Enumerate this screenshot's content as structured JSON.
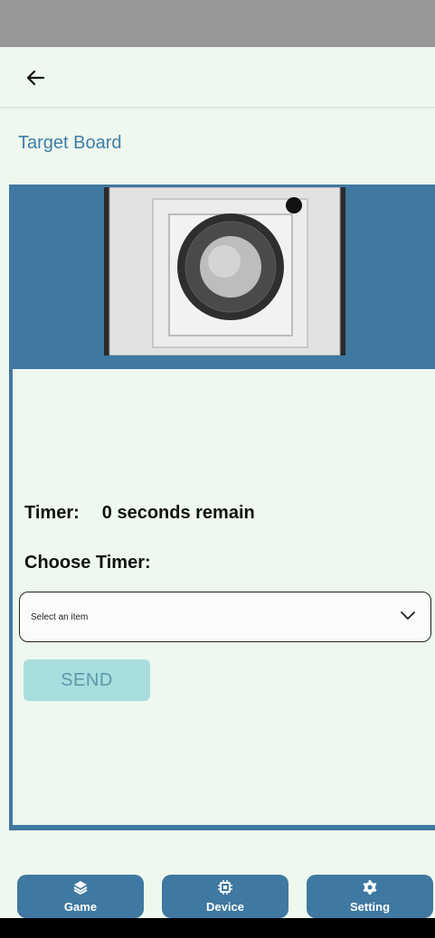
{
  "header": {
    "back_icon": "arrow-left-icon"
  },
  "page": {
    "title": "Target Board"
  },
  "photo": {
    "subject": "target-board-photo"
  },
  "timer": {
    "label": "Timer:",
    "value": "0 seconds remain"
  },
  "choose": {
    "label": "Choose Timer:"
  },
  "select": {
    "placeholder": "Select an item",
    "icon": "chevron-down-icon"
  },
  "send": {
    "label": "SEND"
  },
  "nav": [
    {
      "label": "Game",
      "icon": "layers-icon"
    },
    {
      "label": "Device",
      "icon": "chip-icon"
    },
    {
      "label": "Setting",
      "icon": "gear-icon"
    }
  ],
  "colors": {
    "background": "#eef8ee",
    "primary": "#3f78a0",
    "title": "#3d7ea6",
    "send_button": "#a8dede",
    "send_text": "#5c98aa"
  }
}
